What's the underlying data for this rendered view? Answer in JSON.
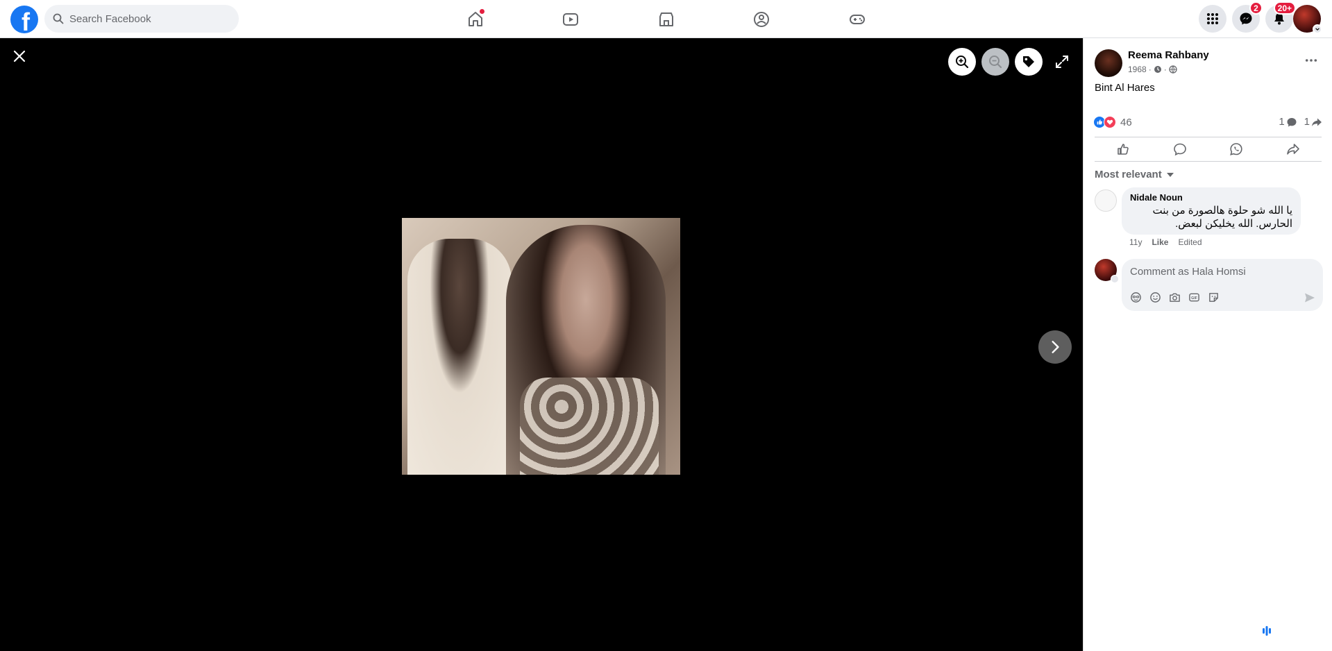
{
  "header": {
    "logo_letter": "f",
    "search_placeholder": "Search Facebook",
    "messenger_badge": "2",
    "notifications_badge": "20+"
  },
  "colors": {
    "brand": "#1877f2",
    "badge": "#e41e3f",
    "viewer_bg": "#000000"
  },
  "post": {
    "author": "Reema Rahbany",
    "year": "1968",
    "meta_separator": "·",
    "caption": "Bint Al Hares",
    "reaction_count": "46",
    "comment_count": "1",
    "share_count": "1"
  },
  "comments": {
    "sort_label": "Most relevant",
    "items": [
      {
        "name": "Nidale Noun",
        "text": "يا الله شو حلوة هالصورة من بنت الحارس. الله يخليكن لبعض.",
        "time": "11y",
        "like_label": "Like",
        "edited_label": "Edited"
      }
    ],
    "compose_placeholder": "Comment as Hala Homsi"
  }
}
